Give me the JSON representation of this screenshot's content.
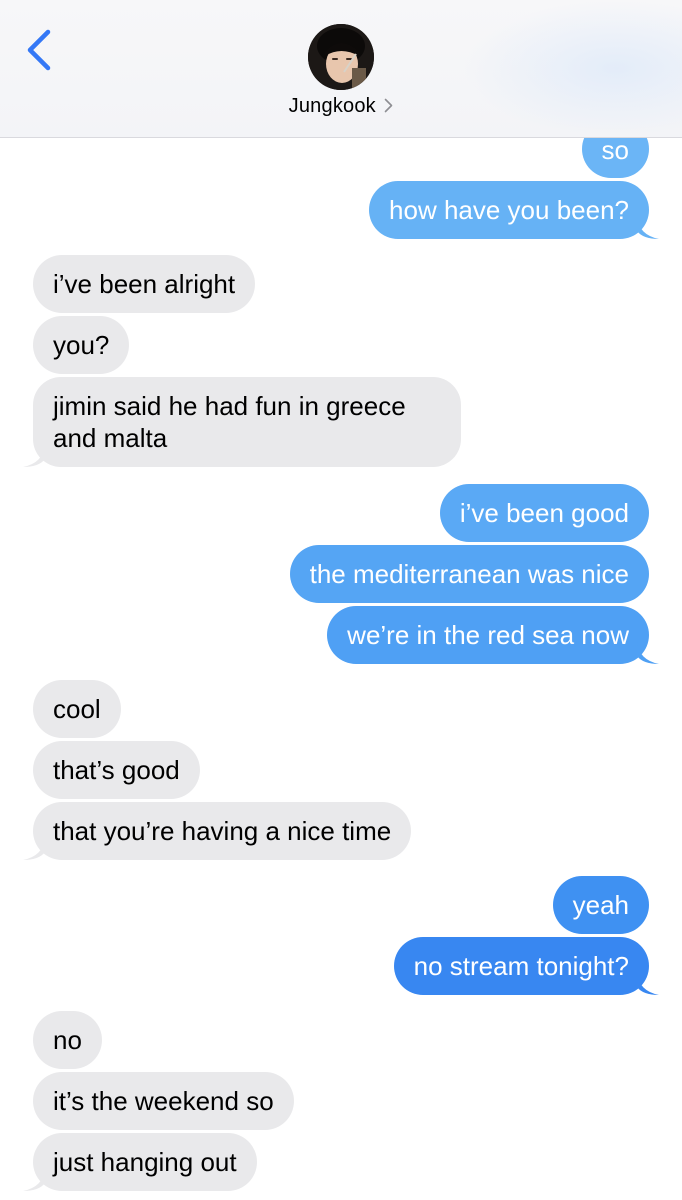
{
  "header": {
    "contact_name": "Jungkook",
    "back_icon": "chevron-left-icon",
    "chevron_icon": "chevron-right-icon"
  },
  "colors": {
    "sent_top": "#6ab4f6",
    "sent_bottom": "#2f7df0",
    "received": "#e9e9eb",
    "ios_blue": "#3478f6"
  },
  "messages": [
    {
      "side": "sent",
      "text": "so"
    },
    {
      "side": "sent",
      "text": "how have you been?"
    },
    {
      "side": "received",
      "text": "i’ve been alright"
    },
    {
      "side": "received",
      "text": "you?"
    },
    {
      "side": "received",
      "text": "jimin said he had fun in greece and malta"
    },
    {
      "side": "sent",
      "text": "i’ve been good"
    },
    {
      "side": "sent",
      "text": "the mediterranean was nice"
    },
    {
      "side": "sent",
      "text": "we’re in the red sea now"
    },
    {
      "side": "received",
      "text": "cool"
    },
    {
      "side": "received",
      "text": "that’s good"
    },
    {
      "side": "received",
      "text": "that you’re having a nice time"
    },
    {
      "side": "sent",
      "text": "yeah"
    },
    {
      "side": "sent",
      "text": "no stream tonight?"
    },
    {
      "side": "received",
      "text": "no"
    },
    {
      "side": "received",
      "text": "it’s the weekend so"
    },
    {
      "side": "received",
      "text": "just hanging out"
    }
  ]
}
